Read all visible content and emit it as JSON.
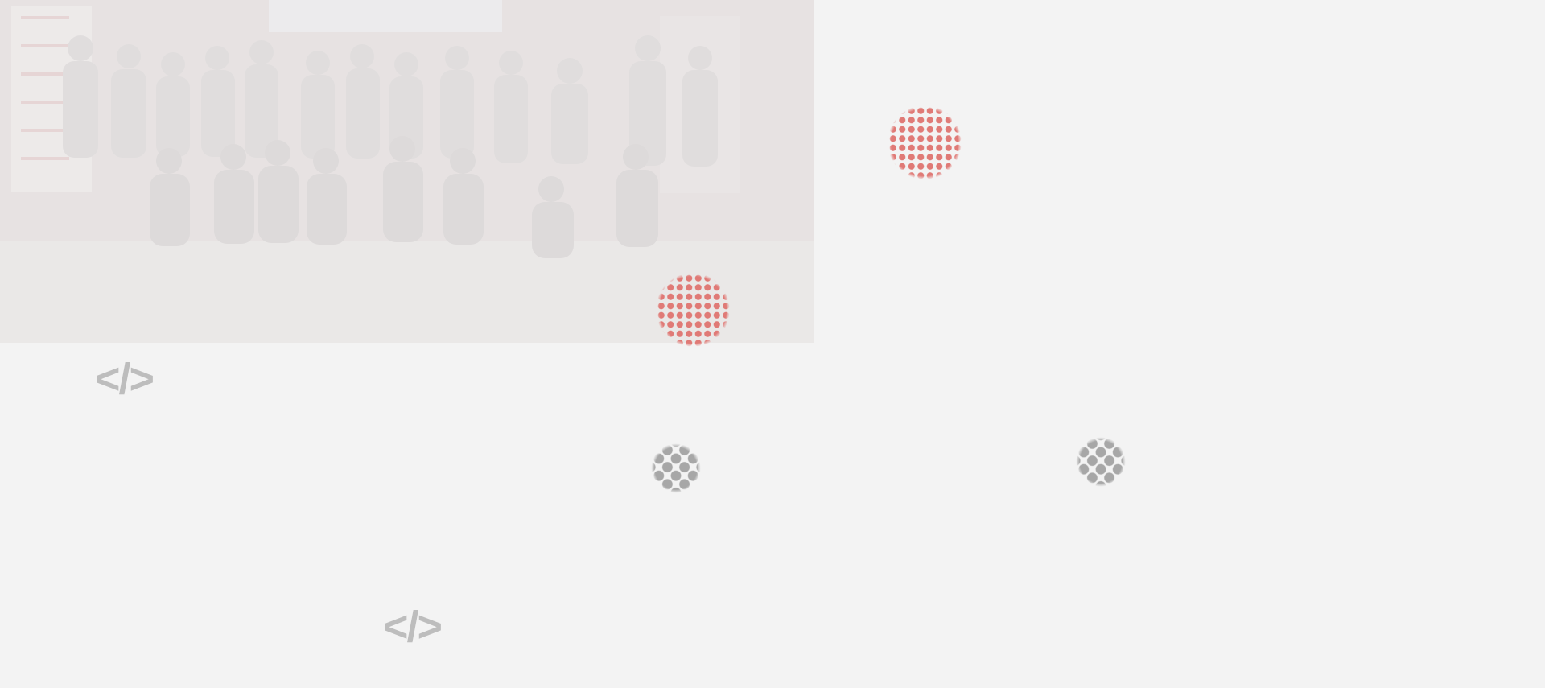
{
  "hero": {
    "photo_subject": "group-photo",
    "overlay_color": "#ebe9e8"
  },
  "decorations": {
    "code_symbol": "</>",
    "code_icon_color": "#bdbdbd",
    "red_dot_color": "#e07a76",
    "grey_dot_color": "#a7a7a7",
    "background_color": "#f3f3f3"
  }
}
